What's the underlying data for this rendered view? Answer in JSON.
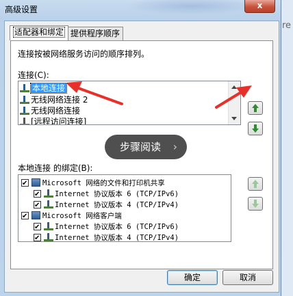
{
  "window": {
    "title": "高级设置",
    "close_glyph": "x"
  },
  "tabs": [
    {
      "label": "适配器和绑定"
    },
    {
      "label": "提供程序顺序"
    }
  ],
  "description": "连接按被网络服务访问的顺序排列。",
  "connections": {
    "label": "连接(C):",
    "items": [
      {
        "label": "本地连接",
        "selected": true
      },
      {
        "label": "无线网络连接 2"
      },
      {
        "label": "无线网络连接"
      },
      {
        "label": "[远程访问连接]"
      }
    ]
  },
  "bindings": {
    "label": "本地连接 的绑定(B):",
    "items": [
      {
        "label": "Microsoft 网络的文件和打印机共享",
        "indent": 0,
        "checked": true
      },
      {
        "label": "Internet 协议版本 6 (TCP/IPv6)",
        "indent": 1,
        "checked": true
      },
      {
        "label": "Internet 协议版本 4 (TCP/IPv4)",
        "indent": 1,
        "checked": true
      },
      {
        "label": "Microsoft 网络客户端",
        "indent": 0,
        "checked": true
      },
      {
        "label": "Internet 协议版本 6 (TCP/IPv6)",
        "indent": 1,
        "checked": true
      },
      {
        "label": "Internet 协议版本 4 (TCP/IPv4)",
        "indent": 1,
        "checked": true
      }
    ]
  },
  "buttons": {
    "ok": "确定",
    "cancel": "取消"
  },
  "overlay": {
    "text": "步骤阅读",
    "chevron": "›"
  },
  "edge_text": "re",
  "colors": {
    "selection": "#3399ff",
    "arrow_green": "#2e8b2e",
    "annotation_red": "#e8302a"
  }
}
